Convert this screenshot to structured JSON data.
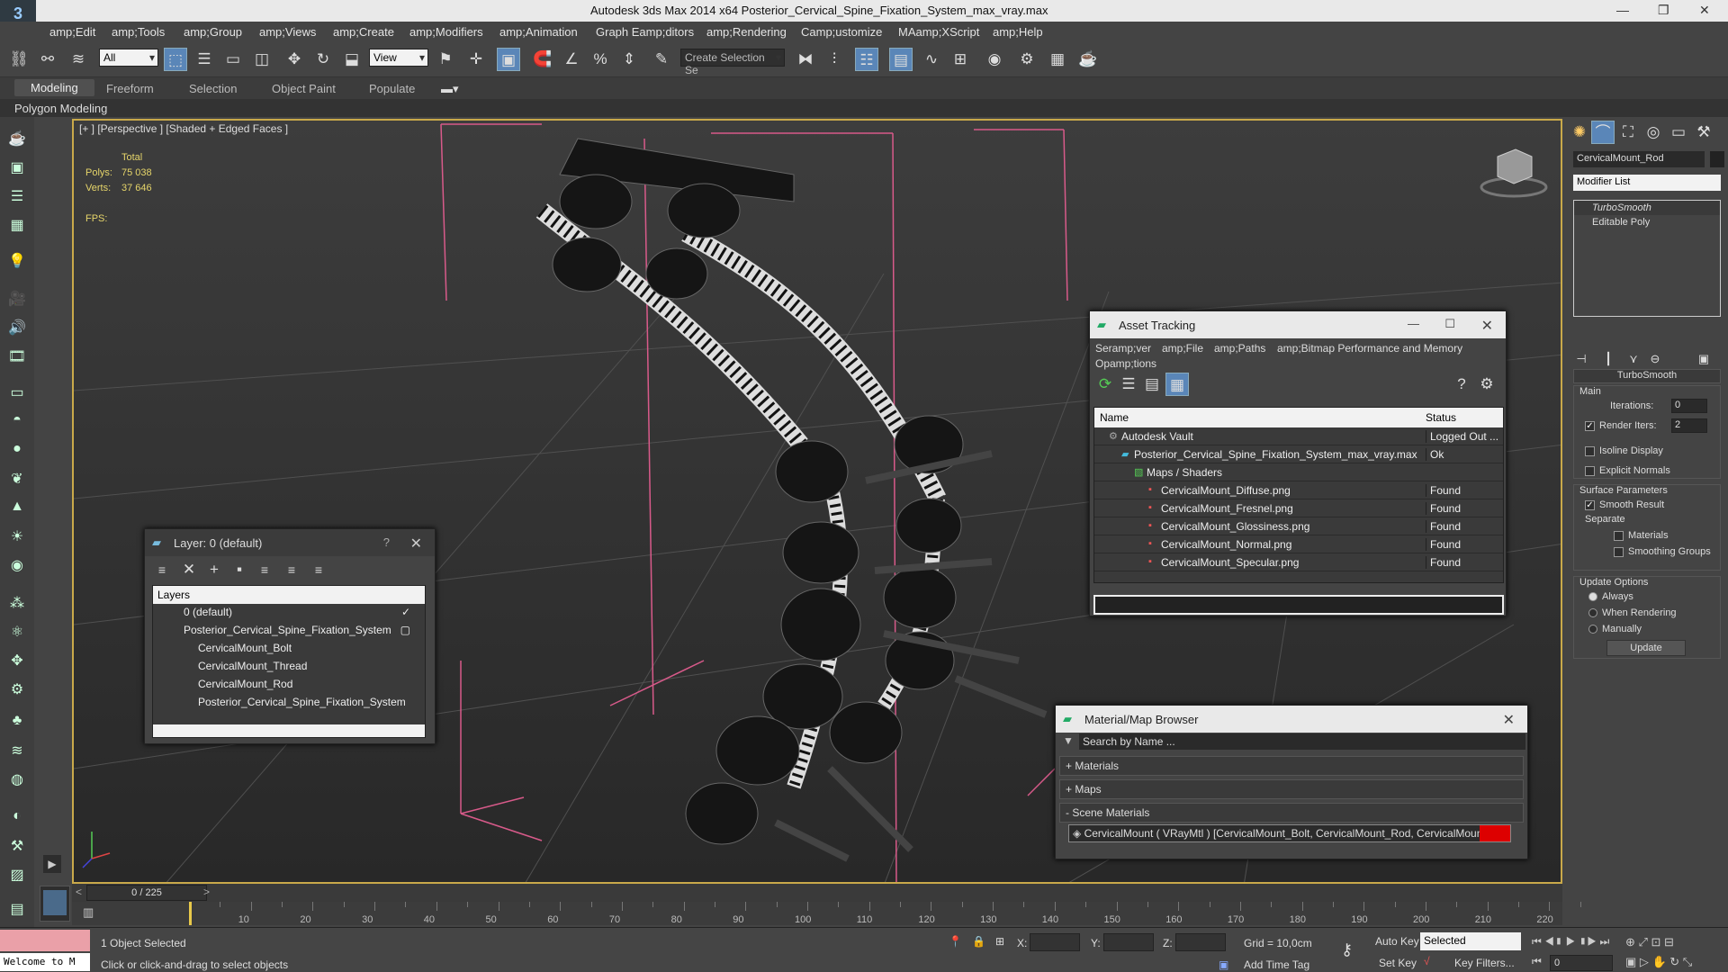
{
  "app": {
    "title": "Autodesk 3ds Max  2014 x64     Posterior_Cervical_Spine_Fixation_System_max_vray.max",
    "minimize": "—",
    "maximize": "❐",
    "close": "✕"
  },
  "menu": [
    "amp;Edit",
    "amp;Tools",
    "amp;Group",
    "amp;Views",
    "amp;Create",
    "amp;Modifiers",
    "amp;Animation",
    "Graph Eamp;ditors",
    "amp;Rendering",
    "Camp;ustomize",
    "MAamp;XScript",
    "amp;Help"
  ],
  "toolbar": {
    "filter": "All",
    "refcoord": "View",
    "selset": "Create Selection Se"
  },
  "ribbon": {
    "tabs": [
      "Modeling",
      "Freeform",
      "Selection",
      "Object Paint",
      "Populate"
    ],
    "sub": "Polygon Modeling"
  },
  "viewport": {
    "label": "[+ ] [Perspective ] [Shaded + Edged Faces ]",
    "total_label": "Total",
    "polys_label": "Polys:",
    "polys": "75 038",
    "verts_label": "Verts:",
    "verts": "37 646",
    "fps_label": "FPS:"
  },
  "layer_win": {
    "title": "Layer: 0 (default)",
    "help": "?",
    "header": "Layers",
    "rows": [
      "0 (default)",
      "Posterior_Cervical_Spine_Fixation_System",
      "CervicalMount_Bolt",
      "CervicalMount_Thread",
      "CervicalMount_Rod",
      "Posterior_Cervical_Spine_Fixation_System"
    ]
  },
  "asset_win": {
    "title": "Asset Tracking",
    "menu": [
      "Seramp;ver",
      "amp;File",
      "amp;Paths",
      "amp;Bitmap Performance and Memory",
      "Opamp;tions"
    ],
    "col_name": "Name",
    "col_status": "Status",
    "rows": [
      {
        "name": "Autodesk Vault",
        "status": "Logged Out ..."
      },
      {
        "name": "Posterior_Cervical_Spine_Fixation_System_max_vray.max",
        "status": "Ok"
      },
      {
        "name": "Maps / Shaders",
        "status": ""
      },
      {
        "name": "CervicalMount_Diffuse.png",
        "status": "Found"
      },
      {
        "name": "CervicalMount_Fresnel.png",
        "status": "Found"
      },
      {
        "name": "CervicalMount_Glossiness.png",
        "status": "Found"
      },
      {
        "name": "CervicalMount_Normal.png",
        "status": "Found"
      },
      {
        "name": "CervicalMount_Specular.png",
        "status": "Found"
      }
    ]
  },
  "mat_win": {
    "title": "Material/Map Browser",
    "search": "Search by Name ...",
    "sections": [
      "+ Materials",
      "+ Maps",
      "- Scene Materials"
    ],
    "item": "CervicalMount  ( VRayMtl )  [CervicalMount_Bolt, CervicalMount_Rod, CervicalMount_Thread]"
  },
  "cmd": {
    "object_name": "CervicalMount_Rod",
    "modifier_list": "Modifier List",
    "stack": [
      "TurboSmooth",
      "Editable Poly"
    ],
    "rollout": "TurboSmooth",
    "main": "Main",
    "iterations_label": "Iterations:",
    "iterations": "0",
    "render_iters_label": "Render Iters:",
    "render_iters": "2",
    "isoline": "Isoline Display",
    "explicit": "Explicit Normals",
    "surface": "Surface Parameters",
    "smooth": "Smooth Result",
    "separate": "Separate",
    "materials": "Materials",
    "smoothing": "Smoothing Groups",
    "update_options": "Update Options",
    "always": "Always",
    "when_rendering": "When Rendering",
    "manually": "Manually",
    "update": "Update"
  },
  "timeline": {
    "frame": "0 / 225",
    "ticks": [
      "10",
      "20",
      "30",
      "40",
      "50",
      "60",
      "70",
      "80",
      "90",
      "100",
      "110",
      "120",
      "130",
      "140",
      "150",
      "160",
      "170",
      "180",
      "190",
      "200",
      "210",
      "220"
    ]
  },
  "status": {
    "welcome": "Welcome to M",
    "selected": "1 Object Selected",
    "hint": "Click or click-and-drag to select objects",
    "x": "X:",
    "y": "Y:",
    "z": "Z:",
    "grid": "Grid = 10,0cm",
    "add_tag": "Add Time Tag",
    "auto_key": "Auto Key",
    "set_key": "Set Key",
    "selected_dd": "Selected",
    "key_filters": "Key Filters...",
    "frame_val": "0"
  }
}
